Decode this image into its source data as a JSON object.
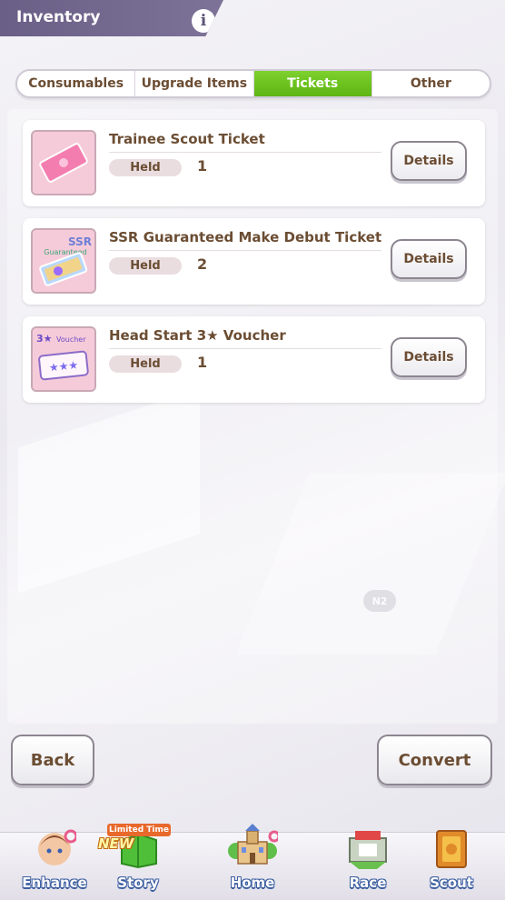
{
  "header": {
    "title": "Inventory",
    "info_icon": "i"
  },
  "tabs": [
    {
      "label": "Consumables",
      "active": false
    },
    {
      "label": "Upgrade Items",
      "active": false
    },
    {
      "label": "Tickets",
      "active": true
    },
    {
      "label": "Other",
      "active": false
    }
  ],
  "items": [
    {
      "name": "Trainee Scout Ticket",
      "held_label": "Held",
      "held": "1",
      "details_label": "Details",
      "icon": "pink-ticket-icon"
    },
    {
      "name": "SSR Guaranteed Make Debut Ticket",
      "held_label": "Held",
      "held": "2",
      "details_label": "Details",
      "icon": "ssr-ticket-icon",
      "icon_text_1": "SSR",
      "icon_text_2": "Guaranteed"
    },
    {
      "name": "Head Start 3★ Voucher",
      "held_label": "Held",
      "held": "1",
      "details_label": "Details",
      "icon": "voucher-icon",
      "icon_text_1": "3★",
      "icon_text_2": "Voucher"
    }
  ],
  "watermark": "N2",
  "footer": {
    "back_label": "Back",
    "convert_label": "Convert"
  },
  "nav": {
    "items": [
      {
        "label": "Enhance",
        "icon": "enhance-icon"
      },
      {
        "label": "Story",
        "icon": "story-icon",
        "badge": "Limited Time",
        "tag": "NEW"
      },
      {
        "label": "Home",
        "icon": "home-icon"
      },
      {
        "label": "Race",
        "icon": "race-icon"
      },
      {
        "label": "Scout",
        "icon": "scout-icon"
      }
    ]
  },
  "colors": {
    "accent": "#6dc41f",
    "header": "#6a5f86",
    "text": "#6b4d33"
  }
}
